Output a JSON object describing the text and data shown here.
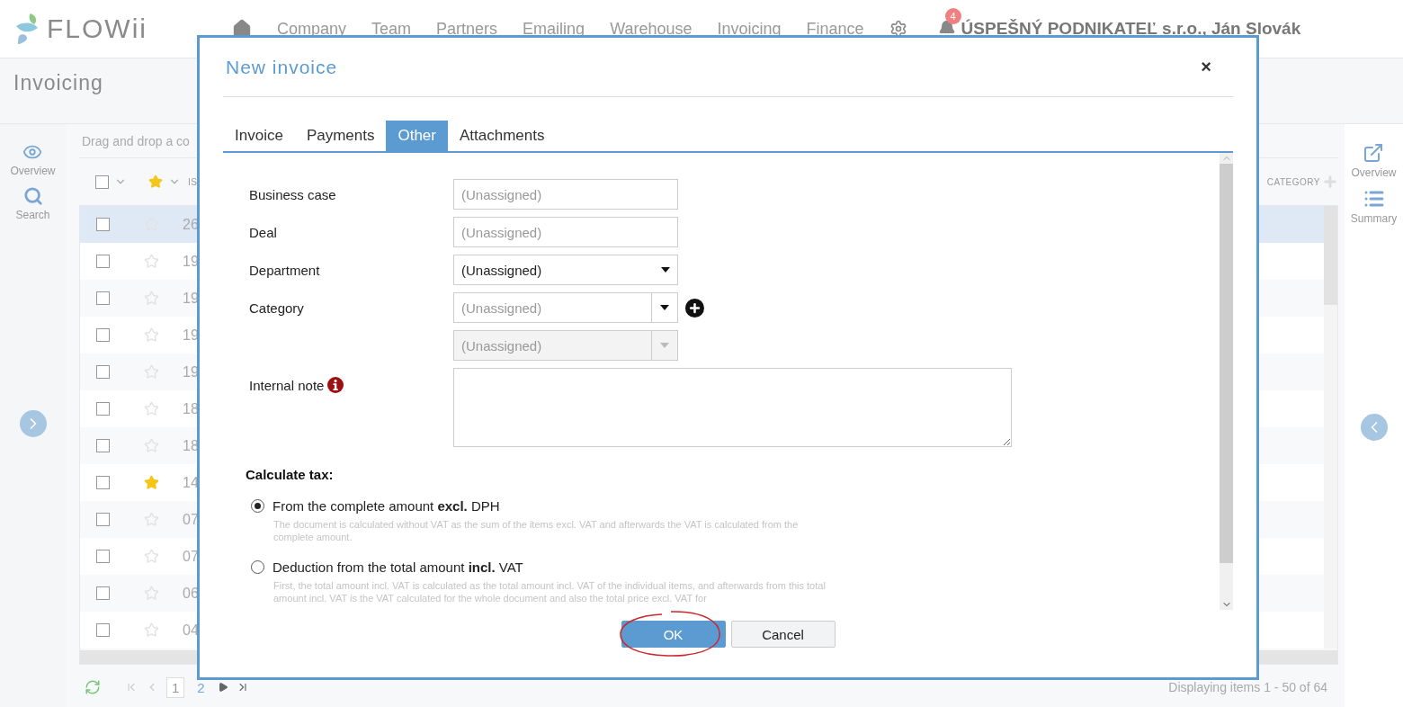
{
  "app": {
    "logo": "FLOWii",
    "nav": [
      "Company",
      "Team",
      "Partners",
      "Emailing",
      "Warehouse",
      "Invoicing",
      "Finance"
    ],
    "notification_count": "4",
    "user": "ÚSPEŠNÝ PODNIKATEĽ s.r.o., Ján Slovák"
  },
  "page_title": "Invoicing",
  "left_sidebar": [
    {
      "kind": "eye",
      "label": "Overview"
    },
    {
      "kind": "search",
      "label": "Search"
    }
  ],
  "right_sidebar": [
    {
      "kind": "external",
      "label": "Overview"
    },
    {
      "kind": "list",
      "label": "Summary"
    }
  ],
  "grid": {
    "group_placeholder": "Drag and drop a co",
    "select_all_checked": false,
    "columns": [
      "IS",
      "CATEGORY"
    ],
    "rows": [
      {
        "column_3": "26",
        "checked": false,
        "starred": false,
        "selected": true
      },
      {
        "column_3": "19",
        "checked": false,
        "starred": false,
        "selected": false
      },
      {
        "column_3": "19",
        "checked": false,
        "starred": false,
        "selected": false
      },
      {
        "column_3": "19",
        "checked": false,
        "starred": false,
        "selected": false
      },
      {
        "column_3": "19",
        "checked": false,
        "starred": false,
        "selected": false
      },
      {
        "column_3": "18",
        "checked": false,
        "starred": false,
        "selected": false
      },
      {
        "column_3": "18",
        "checked": false,
        "starred": false,
        "selected": false
      },
      {
        "column_3": "14",
        "checked": false,
        "starred": true,
        "selected": false
      },
      {
        "column_3": "07",
        "checked": false,
        "starred": false,
        "selected": false
      },
      {
        "column_3": "07",
        "checked": false,
        "starred": false,
        "selected": false
      },
      {
        "column_3": "06",
        "checked": false,
        "starred": false,
        "selected": false
      },
      {
        "column_3": "04",
        "checked": false,
        "starred": false,
        "selected": false
      }
    ]
  },
  "pager": {
    "pages": [
      {
        "label": "1",
        "selected": true
      },
      {
        "label": "2",
        "selected": false
      }
    ],
    "status": "Displaying items 1 - 50 of 64"
  },
  "dialog": {
    "title": "New invoice",
    "close": "×",
    "tabs": [
      {
        "label": "Invoice",
        "selected": false
      },
      {
        "label": "Payments",
        "selected": false
      },
      {
        "label": "Other",
        "selected": true
      },
      {
        "label": "Attachments",
        "selected": false
      }
    ],
    "fields": [
      {
        "label": "Business case",
        "kind": "text",
        "placeholder": "(Unassigned)",
        "disabled": false
      },
      {
        "label": "Deal",
        "kind": "text",
        "placeholder": "(Unassigned)",
        "disabled": false
      },
      {
        "label": "Department",
        "kind": "select",
        "value": "(Unassigned)",
        "disabled": false
      },
      {
        "label": "Category",
        "kind": "combo",
        "placeholder": "(Unassigned)",
        "disabled": false
      },
      {
        "kind": "combo",
        "placeholder": "(Unassigned)",
        "disabled": true
      }
    ],
    "note": {
      "label": "Internal note"
    },
    "tax": {
      "heading": "Calculate tax:",
      "options": [
        {
          "label": "From the complete amount **excl.** DPH",
          "description": "The document is calculated without VAT as the sum of the items excl. VAT and afterwards the VAT is calculated from the complete amount.",
          "selected": true
        },
        {
          "label": "Deduction from the total amount **incl.** VAT",
          "description": "First, the total amount incl. VAT is calculated as the total amount incl. VAT of the individual items, and afterwards from this total amount incl. VAT is the VAT calculated for the whole document and also the total price excl. VAT for",
          "selected": false
        }
      ]
    },
    "buttons": [
      {
        "label": "OK",
        "kind": "primary"
      },
      {
        "label": "Cancel",
        "kind": "secondary"
      }
    ]
  }
}
